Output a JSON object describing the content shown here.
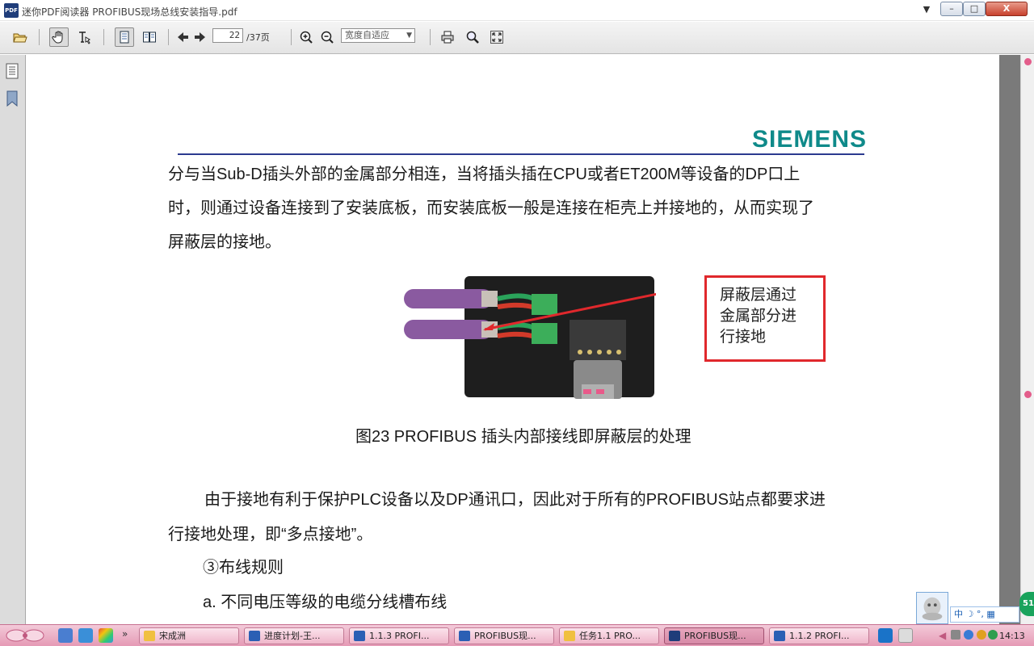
{
  "window": {
    "app_icon_label": "PDF",
    "title": "迷你PDF阅读器  PROFIBUS现场总线安装指导.pdf",
    "minimize_label": "–",
    "maximize_label": "□",
    "close_label": "X"
  },
  "toolbar": {
    "page_current": "22",
    "page_total": "/37页",
    "zoom_mode": "宽度自适应"
  },
  "document": {
    "brand": "SIEMENS",
    "para1_lines": [
      "分与当Sub-D插头外部的金属部分相连，当将插头插在CPU或者ET200M等设备的DP口上",
      "时，则通过设备连接到了安装底板，而安装底板一般是连接在柜壳上并接地的，从而实现了",
      "屏蔽层的接地。"
    ],
    "callout_lines": [
      "屏蔽层通过",
      "金属部分进",
      "行接地"
    ],
    "caption": "图23  PROFIBUS 插头内部接线即屏蔽层的处理",
    "para2_lines": [
      "由于接地有利于保护PLC设备以及DP通讯口，因此对于所有的PROFIBUS站点都要求进",
      "行接地处理，即“多点接地”。"
    ],
    "heading": "③布线规则",
    "item_a": "a.   不同电压等级的电缆分线槽布线"
  },
  "taskbar": {
    "quicklaunch_more": "»",
    "tasks": [
      {
        "label": "宋成洲",
        "icon": "folder-icon"
      },
      {
        "label": "进度计划-王...",
        "icon": "word-icon"
      },
      {
        "label": "1.1.3 PROFI...",
        "icon": "word-icon"
      },
      {
        "label": "PROFIBUS现...",
        "icon": "word-icon"
      },
      {
        "label": "任务1.1 PRO...",
        "icon": "folder-icon"
      },
      {
        "label": "PROFIBUS现...",
        "icon": "pdf-icon"
      },
      {
        "label": "1.1.2 PROFI...",
        "icon": "word-icon"
      }
    ],
    "clock": "14:13"
  },
  "overlay": {
    "ime_text": "中 ☽ °, ▦",
    "badge": "51"
  },
  "colors": {
    "brand": "#0f8a8a",
    "rule": "#2b3a8f",
    "callout_border": "#e0282c",
    "taskbar": "#e59ab5"
  }
}
